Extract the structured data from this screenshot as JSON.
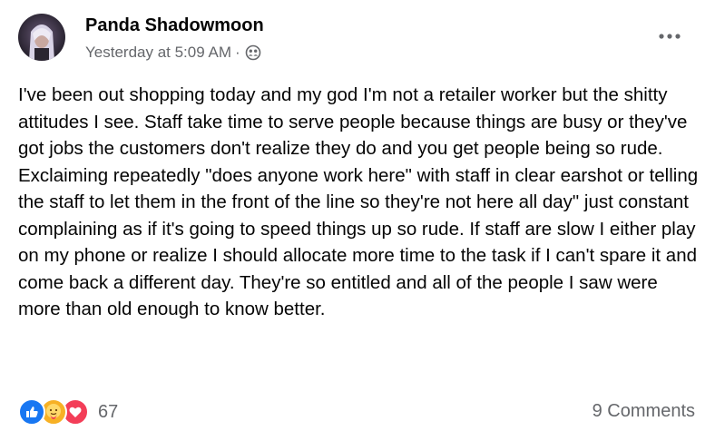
{
  "post": {
    "author": "Panda Shadowmoon",
    "timestamp": "Yesterday at 5:09 AM",
    "separator": "·",
    "privacy_icon": "friends-icon",
    "more_icon": "more-options-icon",
    "text": "I've been out shopping today and my god I'm not a retailer worker but the shitty attitudes I see. Staff take time to serve people because things are busy or they've got jobs the customers don't realize they do and you get people being so rude. Exclaiming repeatedly \"does anyone work here\" with staff in clear earshot or telling the staff to let them in the front of the line so they're not here all day\" just constant complaining as if it's going to speed things up so rude. If staff are slow I either play on my phone or realize I should allocate more time to the task if I can't spare it and come back a different day. They're so entitled and all of the people I saw were more than old enough to know better.",
    "reactions": {
      "icons": [
        "like-icon",
        "care-icon",
        "love-icon"
      ],
      "count": "67"
    },
    "comments": "9 Comments"
  },
  "colors": {
    "text": "#050505",
    "secondary": "#65676b",
    "like": "#1877f2",
    "love": "#f33e58",
    "care": "#f7b125"
  }
}
